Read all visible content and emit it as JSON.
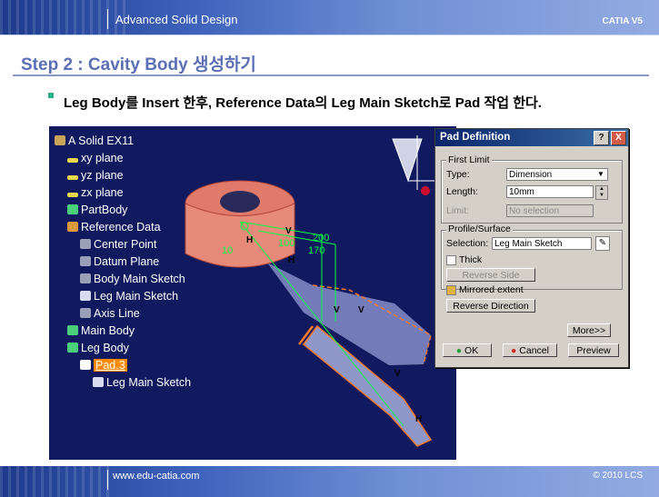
{
  "header": {
    "title": "Advanced Solid Design",
    "brand": "CATIA V5"
  },
  "step": {
    "title": "Step 2 : Cavity Body 생성하기"
  },
  "instruction": "Leg Body를 Insert 한후, Reference Data의 Leg Main Sketch로 Pad 작업 한다.",
  "tree": {
    "root": "A Solid EX11",
    "items": [
      "xy plane",
      "yz plane",
      "zx plane",
      "PartBody",
      "Reference Data",
      "Center Point",
      "Datum Plane",
      "Body Main Sketch",
      "Leg Main Sketch",
      "Axis Line",
      "Main Body",
      "Leg Body",
      "Pad.3",
      "Leg Main Sketch"
    ]
  },
  "model": {
    "dims": [
      "200",
      "170",
      "100",
      "10"
    ],
    "marks": [
      "H",
      "V",
      "H",
      "V",
      "V",
      "V",
      "H"
    ]
  },
  "dialog": {
    "title": "Pad Definition",
    "help": "?",
    "close": "X",
    "first_limit": "First Limit",
    "type_label": "Type:",
    "type_value": "Dimension",
    "length_label": "Length:",
    "length_value": "10mm",
    "limit_label": "Limit:",
    "limit_value": "No selection",
    "profile_surface": "Profile/Surface",
    "selection_label": "Selection:",
    "selection_value": "Leg Main Sketch",
    "thick": "Thick",
    "reverse_side": "Reverse Side",
    "mirrored_extent": "Mirrored extent",
    "reverse_direction": "Reverse Direction",
    "more": "More>>",
    "ok": "OK",
    "cancel": "Cancel",
    "preview": "Preview"
  },
  "footer": {
    "url": "www.edu-catia.com",
    "copyright": "© 2010 LCS"
  },
  "colors": {
    "accent": "#5b6fb5",
    "viewport_bg": "#111a5e",
    "model": "#e07a6a",
    "selected": "#ff8a00"
  }
}
